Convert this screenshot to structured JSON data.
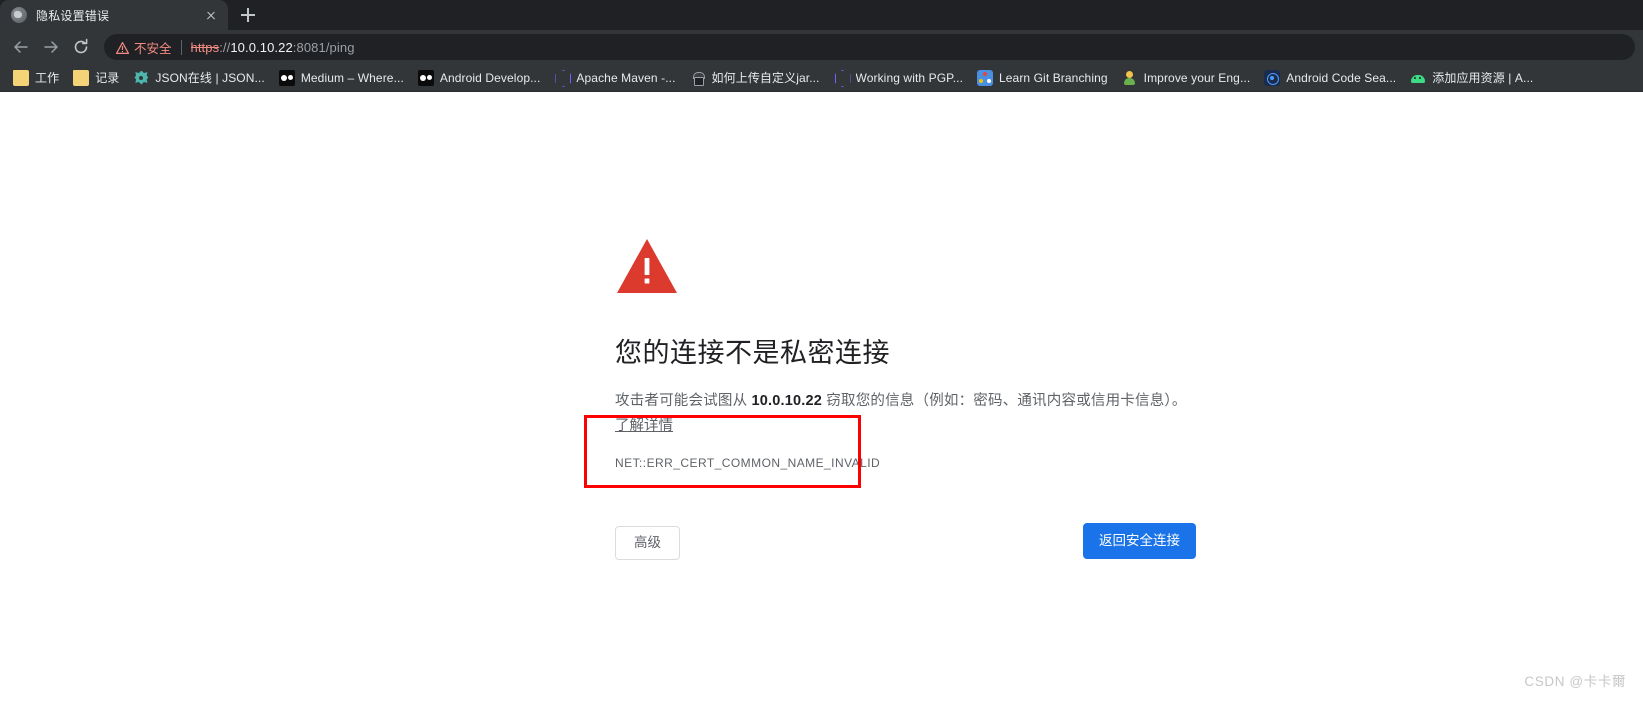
{
  "window": {
    "tab": {
      "title": "隐私设置错误",
      "favicon": "globe-icon",
      "close_label": "×"
    },
    "new_tab_label": "+"
  },
  "toolbar": {
    "back_label": "←",
    "forward_label": "→",
    "reload_label": "⟳",
    "omnibox": {
      "security_label": "不安全",
      "security_icon": "warning-triangle-icon",
      "url_scheme": "https",
      "url_separator": "://",
      "url_host": "10.0.10.22",
      "url_path": ":8081/ping",
      "full_url": "https://10.0.10.22:8081/ping"
    }
  },
  "bookmarks": [
    {
      "label": "工作",
      "icon": "folder-icon",
      "icon_class": "ico-folder"
    },
    {
      "label": "记录",
      "icon": "folder-icon",
      "icon_class": "ico-folder"
    },
    {
      "label": "JSON在线 | JSON...",
      "icon": "json-icon",
      "icon_class": "ico-json"
    },
    {
      "label": "Medium – Where...",
      "icon": "medium-icon",
      "icon_class": "ico-medium"
    },
    {
      "label": "Android Develop...",
      "icon": "medium-icon",
      "icon_class": "ico-medium"
    },
    {
      "label": "Apache Maven -...",
      "icon": "hexagon-icon",
      "icon_class": "ico-hex"
    },
    {
      "label": "如何上传自定义jar...",
      "icon": "jar-icon",
      "icon_class": "ico-jar"
    },
    {
      "label": "Working with PGP...",
      "icon": "hexagon-icon",
      "icon_class": "ico-hex"
    },
    {
      "label": "Learn Git Branching",
      "icon": "git-branch-icon",
      "icon_class": "ico-git"
    },
    {
      "label": "Improve your Eng...",
      "icon": "person-icon",
      "icon_class": "ico-person"
    },
    {
      "label": "Android Code Sea...",
      "icon": "android-code-search-icon",
      "icon_class": "ico-acs"
    },
    {
      "label": "添加应用资源 | A...",
      "icon": "android-icon",
      "icon_class": "ico-android"
    }
  ],
  "page": {
    "error_icon": "red-warning-triangle-icon",
    "title": "您的连接不是私密连接",
    "body_prefix": "攻击者可能会试图从 ",
    "body_host": "10.0.10.22",
    "body_suffix": " 窃取您的信息（例如：密码、通讯内容或信用卡信息）。",
    "learn_more": "了解详情",
    "error_code": "NET::ERR_CERT_COMMON_NAME_INVALID",
    "advanced_button": "高级",
    "safety_button": "返回安全连接"
  },
  "annotation": {
    "highlight_color": "#ff0000",
    "target": "error-code"
  },
  "watermark": "CSDN @卡卡爾",
  "colors": {
    "chrome_bg": "#323639",
    "tabstrip_bg": "#202124",
    "omnibox_bg": "#202124",
    "danger": "#f28b82",
    "error_red": "#db3a2c",
    "primary_blue": "#1a73e8",
    "text_primary": "#202124",
    "text_secondary": "#5f6368"
  }
}
